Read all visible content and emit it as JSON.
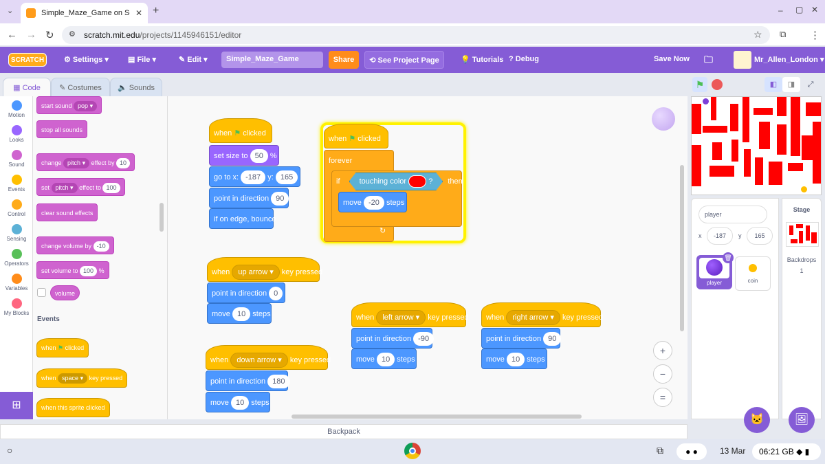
{
  "browser": {
    "tab_title": "Simple_Maze_Game on Scratc",
    "url_host": "scratch.mit.edu",
    "url_path": "/projects/1145946151/editor"
  },
  "menubar": {
    "logo": "SCRATCH",
    "settings": "Settings",
    "file": "File",
    "edit": "Edit",
    "project_title": "Simple_Maze_Game",
    "share": "Share",
    "see_project_page": "See Project Page",
    "tutorials": "Tutorials",
    "debug": "Debug",
    "save_now": "Save Now",
    "username": "Mr_Allen_London"
  },
  "tabs": {
    "code": "Code",
    "costumes": "Costumes",
    "sounds": "Sounds"
  },
  "categories": [
    {
      "label": "Motion",
      "color": "#4c97ff"
    },
    {
      "label": "Looks",
      "color": "#9966ff"
    },
    {
      "label": "Sound",
      "color": "#cf63cf"
    },
    {
      "label": "Events",
      "color": "#ffbf00"
    },
    {
      "label": "Control",
      "color": "#ffab19"
    },
    {
      "label": "Sensing",
      "color": "#5cb1d6"
    },
    {
      "label": "Operators",
      "color": "#59c059"
    },
    {
      "label": "Variables",
      "color": "#ff8c1a"
    },
    {
      "label": "My Blocks",
      "color": "#ff6680"
    }
  ],
  "palette": {
    "start_sound": "start sound",
    "start_sound_val": "pop",
    "stop_all_sounds": "stop all sounds",
    "change": "change",
    "pitch": "pitch",
    "effect_by": "effect by",
    "change_val": "10",
    "set": "set",
    "effect_to": "effect to",
    "set_val": "100",
    "clear_sound_effects": "clear sound effects",
    "change_volume_by": "change volume by",
    "change_volume_val": "-10",
    "set_volume_to": "set volume to",
    "set_volume_val": "100",
    "percent": "%",
    "volume": "volume",
    "events_heading": "Events",
    "when": "when",
    "clicked": "clicked",
    "space": "space",
    "key_pressed": "key pressed",
    "when_sprite_clicked": "when this sprite clicked"
  },
  "script1": {
    "when": "when",
    "clicked": "clicked",
    "set_size_to": "set size to",
    "size": "50",
    "pct": "%",
    "go_to_x": "go to x:",
    "x": "-187",
    "y_label": "y:",
    "y": "165",
    "point_in_direction": "point in direction",
    "dir": "90",
    "if_on_edge": "if on edge, bounce"
  },
  "script2": {
    "when": "when",
    "clicked": "clicked",
    "forever": "forever",
    "if": "if",
    "touching_color": "touching color",
    "q": "?",
    "then": "then",
    "move": "move",
    "steps_val": "-20",
    "steps": "steps"
  },
  "script3": {
    "when": "when",
    "key": "up arrow",
    "key_pressed": "key pressed",
    "point": "point in direction",
    "dir": "0",
    "move": "move",
    "steps_val": "10",
    "steps": "steps"
  },
  "script4": {
    "when": "when",
    "key": "down arrow",
    "key_pressed": "key pressed",
    "point": "point in direction",
    "dir": "180",
    "move": "move",
    "steps_val": "10",
    "steps": "steps"
  },
  "script5": {
    "when": "when",
    "key": "left arrow",
    "key_pressed": "key pressed",
    "point": "point in direction",
    "dir": "-90",
    "move": "move",
    "steps_val": "10",
    "steps": "steps"
  },
  "script6": {
    "when": "when",
    "key": "right arrow",
    "key_pressed": "key pressed",
    "point": "point in direction",
    "dir": "90",
    "move": "move",
    "steps_val": "10",
    "steps": "steps"
  },
  "zoom": {
    "in": "+",
    "out": "−",
    "reset": "="
  },
  "backpack": "Backpack",
  "sprite_info": {
    "name": "player",
    "x_label": "x",
    "x": "-187",
    "y_label": "y",
    "y": "165"
  },
  "sprites": [
    {
      "name": "player"
    },
    {
      "name": "coin"
    }
  ],
  "stage_pane": {
    "title": "Stage",
    "backdrops_label": "Backdrops",
    "backdrops_count": "1"
  },
  "shelf": {
    "date": "13 Mar",
    "time": "06:21",
    "region": "GB"
  }
}
